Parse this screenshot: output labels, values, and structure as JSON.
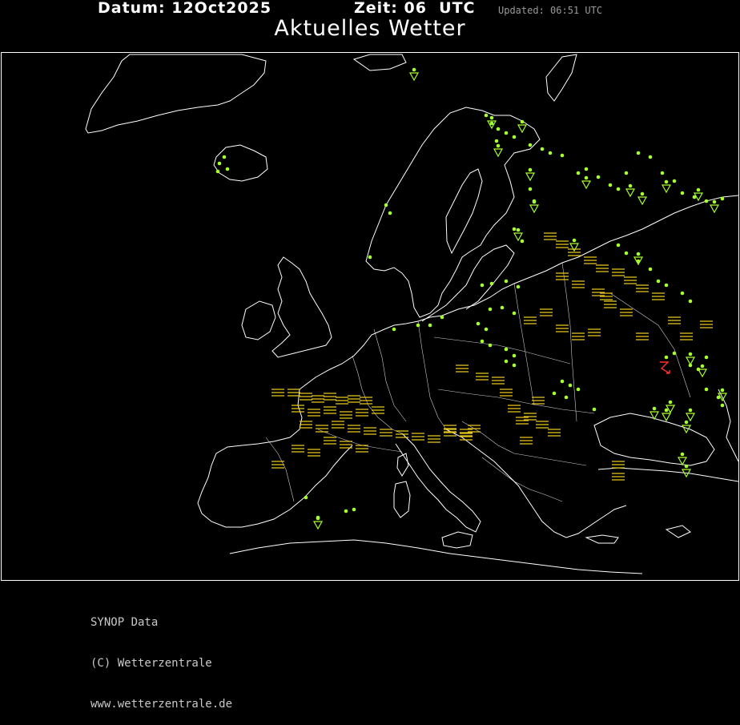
{
  "header": {
    "datum_label": "Datum:",
    "datum_value": "12Oct2025",
    "zeit_label": "Zeit:",
    "zeit_value": "06",
    "zeit_unit": "UTC",
    "updated": "Updated: 06:51 UTC"
  },
  "title": "Aktuelles Wetter",
  "footer": {
    "line1": "SYNOP Data",
    "line2": "(C) Wetterzentrale",
    "line3": "www.wetterzentrale.de"
  },
  "colors": {
    "background": "#000000",
    "coastline": "#ffffff",
    "rain_symbol": "#a6ff2e",
    "fog_symbol": "#e8c81e",
    "storm_symbol": "#ff3030"
  },
  "legend_symbols": [
    "rain-dot",
    "shower-triangle",
    "fog-lines",
    "thunderstorm-arrow"
  ]
}
